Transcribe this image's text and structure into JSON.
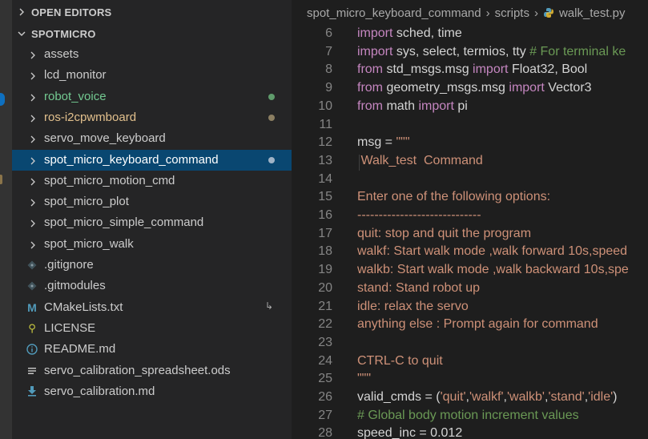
{
  "colors": {
    "accent_blue": "#0e70c0",
    "selection": "#094771",
    "git_added": "#73c991",
    "git_modified": "#e2c08d",
    "keyword": "#c586c0",
    "string": "#ce9178",
    "comment": "#6a9955"
  },
  "sidebar": {
    "open_editors_label": "OPEN EDITORS",
    "project_label": "SPOTMICRO",
    "items": [
      {
        "label": "assets",
        "type": "folder"
      },
      {
        "label": "lcd_monitor",
        "type": "folder"
      },
      {
        "label": "robot_voice",
        "type": "folder",
        "status": "added"
      },
      {
        "label": "ros-i2cpwmboard",
        "type": "folder",
        "status": "modified"
      },
      {
        "label": "servo_move_keyboard",
        "type": "folder"
      },
      {
        "label": "spot_micro_keyboard_command",
        "type": "folder",
        "status": "selected"
      },
      {
        "label": "spot_micro_motion_cmd",
        "type": "folder"
      },
      {
        "label": "spot_micro_plot",
        "type": "folder"
      },
      {
        "label": "spot_micro_simple_command",
        "type": "folder"
      },
      {
        "label": "spot_micro_walk",
        "type": "folder"
      },
      {
        "label": ".gitignore",
        "type": "file",
        "icon": "git-icon"
      },
      {
        "label": ".gitmodules",
        "type": "file",
        "icon": "git-icon"
      },
      {
        "label": "CMakeLists.txt",
        "type": "file",
        "icon": "cmake-icon",
        "decoration": "↳"
      },
      {
        "label": "LICENSE",
        "type": "file",
        "icon": "license-icon"
      },
      {
        "label": "README.md",
        "type": "file",
        "icon": "info-icon"
      },
      {
        "label": "servo_calibration_spreadsheet.ods",
        "type": "file",
        "icon": "lines-icon"
      },
      {
        "label": "servo_calibration.md",
        "type": "file",
        "icon": "download-icon"
      }
    ]
  },
  "breadcrumb": {
    "parts": [
      "spot_micro_keyboard_command",
      "scripts",
      "walk_test.py"
    ]
  },
  "code": {
    "lines": [
      {
        "n": "6",
        "spans": [
          [
            "kw",
            "import"
          ],
          [
            "",
            "sched, time"
          ]
        ]
      },
      {
        "n": "7",
        "spans": [
          [
            "kw",
            "import"
          ],
          [
            "",
            "sys, select, termios, tty "
          ],
          [
            "cm",
            "# For terminal ke"
          ]
        ]
      },
      {
        "n": "8",
        "spans": [
          [
            "kw",
            "from"
          ],
          [
            "",
            "std_msgs.msg "
          ],
          [
            "kw",
            "import"
          ],
          [
            "",
            "Float32, Bool"
          ]
        ]
      },
      {
        "n": "9",
        "spans": [
          [
            "kw",
            "from"
          ],
          [
            "",
            "geometry_msgs.msg "
          ],
          [
            "kw",
            "import"
          ],
          [
            "",
            "Vector3"
          ]
        ]
      },
      {
        "n": "10",
        "spans": [
          [
            "kw",
            "from"
          ],
          [
            "",
            "math "
          ],
          [
            "kw",
            "import"
          ],
          [
            "",
            "pi"
          ]
        ]
      },
      {
        "n": "11",
        "spans": []
      },
      {
        "n": "12",
        "spans": [
          [
            "",
            "msg = "
          ],
          [
            "st",
            "\"\"\""
          ]
        ]
      },
      {
        "n": "13",
        "spans": [
          [
            "st",
            " Walk_test  Command"
          ]
        ]
      },
      {
        "n": "14",
        "spans": []
      },
      {
        "n": "15",
        "spans": [
          [
            "st",
            "Enter one of the following options:"
          ]
        ]
      },
      {
        "n": "16",
        "spans": [
          [
            "st",
            "-----------------------------"
          ]
        ]
      },
      {
        "n": "17",
        "spans": [
          [
            "st",
            "quit: stop and quit the program"
          ]
        ]
      },
      {
        "n": "18",
        "spans": [
          [
            "st",
            "walkf: Start walk mode ,walk forward 10s,speed"
          ]
        ]
      },
      {
        "n": "19",
        "spans": [
          [
            "st",
            "walkb: Start walk mode ,walk backward 10s,spe"
          ]
        ]
      },
      {
        "n": "20",
        "spans": [
          [
            "st",
            "stand: Stand robot up"
          ]
        ]
      },
      {
        "n": "21",
        "spans": [
          [
            "st",
            "idle: relax the servo"
          ]
        ]
      },
      {
        "n": "22",
        "spans": [
          [
            "st",
            "anything else : Prompt again for command"
          ]
        ]
      },
      {
        "n": "23",
        "spans": []
      },
      {
        "n": "24",
        "spans": [
          [
            "st",
            "CTRL-C to quit"
          ]
        ]
      },
      {
        "n": "25",
        "spans": [
          [
            "st",
            "\"\"\""
          ]
        ]
      },
      {
        "n": "26",
        "spans": [
          [
            "",
            "valid_cmds = ("
          ],
          [
            "st",
            "'quit'"
          ],
          [
            "",
            ","
          ],
          [
            "st",
            "'walkf'"
          ],
          [
            "",
            ","
          ],
          [
            "st",
            "'walkb'"
          ],
          [
            "",
            ","
          ],
          [
            "st",
            "'stand'"
          ],
          [
            "",
            ","
          ],
          [
            "st",
            "'idle'"
          ],
          [
            "",
            ")"
          ]
        ]
      },
      {
        "n": "27",
        "spans": [
          [
            "cm",
            "# Global body motion increment values"
          ]
        ]
      },
      {
        "n": "28",
        "spans": [
          [
            "",
            "speed_inc = 0.012"
          ]
        ]
      }
    ]
  }
}
